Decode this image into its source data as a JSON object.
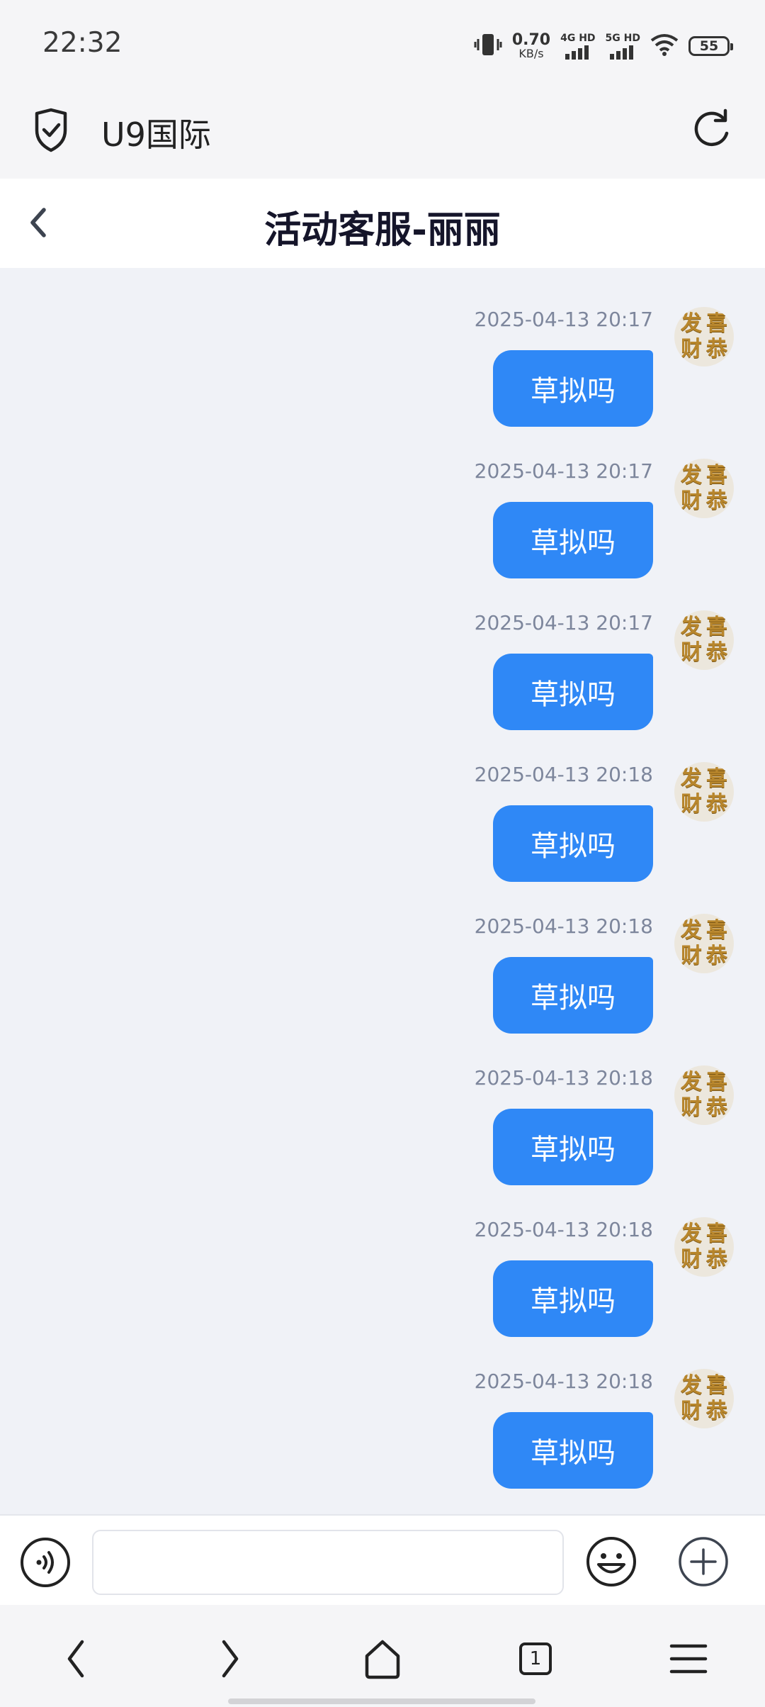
{
  "status_bar": {
    "time": "22:32",
    "net_speed_value": "0.70",
    "net_speed_unit": "KB/s",
    "sim1_label": "4G HD",
    "sim2_label": "5G HD",
    "battery": "55",
    "icons": [
      "vibrate-icon",
      "signal-icon",
      "wifi-icon",
      "battery-icon"
    ]
  },
  "browser": {
    "title": "U9国际",
    "icons": [
      "shield-check-icon",
      "reload-icon"
    ]
  },
  "chat": {
    "title": "活动客服-丽丽",
    "messages": [
      {
        "timestamp": "2025-04-13 20:17",
        "text": "草拟吗"
      },
      {
        "timestamp": "2025-04-13 20:17",
        "text": "草拟吗"
      },
      {
        "timestamp": "2025-04-13 20:17",
        "text": "草拟吗"
      },
      {
        "timestamp": "2025-04-13 20:18",
        "text": "草拟吗"
      },
      {
        "timestamp": "2025-04-13 20:18",
        "text": "草拟吗"
      },
      {
        "timestamp": "2025-04-13 20:18",
        "text": "草拟吗"
      },
      {
        "timestamp": "2025-04-13 20:18",
        "text": "草拟吗"
      },
      {
        "timestamp": "2025-04-13 20:18",
        "text": "草拟吗"
      }
    ],
    "avatar_chars": [
      "发",
      "喜",
      "财",
      "恭"
    ]
  },
  "input": {
    "value": "",
    "placeholder": ""
  },
  "nav": {
    "tab_count": "1"
  },
  "colors": {
    "bubble": "#2f88f6",
    "message_bg": "#f0f2f7",
    "timestamp": "#7d869c"
  }
}
